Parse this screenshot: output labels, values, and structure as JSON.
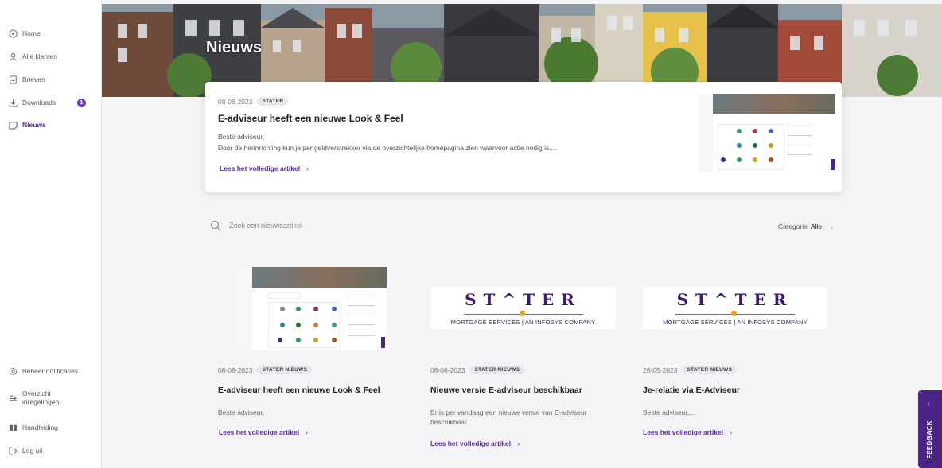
{
  "sidebar": {
    "items": [
      {
        "label": "Home",
        "icon": "compass-icon"
      },
      {
        "label": "Alle klanten",
        "icon": "person-icon"
      },
      {
        "label": "Brieven",
        "icon": "document-icon"
      },
      {
        "label": "Downloads",
        "icon": "download-icon",
        "badge": "1"
      },
      {
        "label": "Nieuws",
        "icon": "news-icon",
        "active": true
      }
    ],
    "bottom_items": [
      {
        "label": "Beheer notificaties",
        "icon": "gear-icon"
      },
      {
        "label": "Overzicht inregelingen",
        "icon": "sliders-icon"
      },
      {
        "label": "Handleiding",
        "icon": "book-icon"
      },
      {
        "label": "Log uit",
        "icon": "logout-icon"
      }
    ]
  },
  "hero": {
    "title": "Nieuws"
  },
  "featured": {
    "date": "08-08-2023",
    "tag": "STATER",
    "title": "E-adviseur heeft een nieuwe Look & Feel",
    "text_line1": "Beste adviseur,",
    "text_line2": "Door de herinrichting kun je per geldverstrekker via de overzichtelijke homepagina zien waarvoor actie nodig is....",
    "link": "Lees het volledige artikel"
  },
  "search": {
    "placeholder": "Zoek een nieuwsartikel"
  },
  "filter": {
    "label": "Categorie",
    "value": "Alle"
  },
  "articles": [
    {
      "date": "08-08-2023",
      "tag": "STATER NIEUWS",
      "title": "E-adviseur heeft een nieuwe Look & Feel",
      "text": "Beste adviseur,",
      "link": "Lees het volledige artikel"
    },
    {
      "date": "08-08-2023",
      "tag": "STATER NIEUWS",
      "title": "Nieuwe versie E-adviseur beschikbaar",
      "text": "Er is per vandaag een nieuwe versie van E-adviseur beschikbaar.",
      "link": "Lees het volledige artikel"
    },
    {
      "date": "26-05-2023",
      "tag": "STATER NIEUWS",
      "title": "Je-relatie via E-Adviseur",
      "text": "Beste adviseur,...",
      "link": "Lees het volledige artikel"
    }
  ],
  "logo": {
    "word_left": "ST",
    "word_right": "TER",
    "subtitle": "MORTGAGE SERVICES | AN INFOSYS COMPANY"
  },
  "feedback": {
    "label": "FEEDBACK"
  },
  "colors": {
    "accent": "#5b2aa0",
    "feedback_bg": "#4b2585",
    "badge": "#6d3bbf"
  }
}
